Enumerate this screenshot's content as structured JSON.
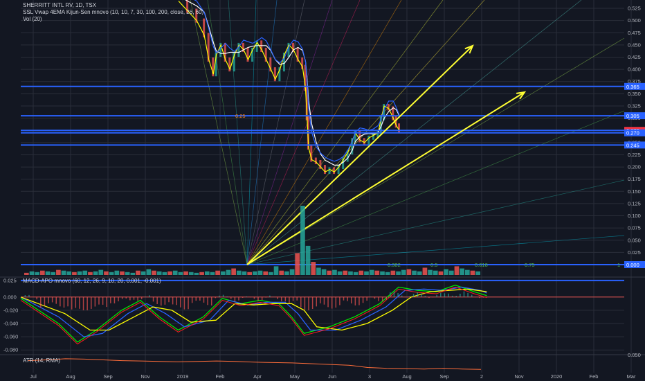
{
  "legend": {
    "symbol": "SHERRITT INTL RV, 1D, TSX",
    "ssl": "SSL Vwap 4EMA Kijun-Sen mnovo (10, 10, 7, 30, 100, 200, close, 26, 60)",
    "vol": "Vol (20)",
    "macd": "MACD-APO mnovo (60, 12, 26, 9, 10, 20, 0.001, -0.001)",
    "atr": "ATR (14, RMA)"
  },
  "colors": {
    "background": "#131722",
    "grid": "#2a2e39",
    "axis_text": "#b2b5be",
    "bull": "#26a69a",
    "bear": "#ef5350",
    "hline": "#2962ff",
    "arrow": "#ffff33",
    "white_line": "#ffffff",
    "blue_line": "#2962ff",
    "yellow_line": "#ffff00",
    "green_line": "#00e600",
    "red_line": "#ff2020",
    "atr_line": "#ff6d3a",
    "badge_red": "#f23645"
  },
  "chart_data": [
    {
      "type": "line",
      "panel": "price",
      "title": "SHERRITT INTL RV, 1D, TSX",
      "x_axis_labels": [
        "Jul",
        "Aug",
        "Sep",
        "Nov",
        "2019",
        "Feb",
        "Apr",
        "May",
        "Jun",
        "3",
        "Aug",
        "Sep",
        "2",
        "Nov",
        "2020",
        "Feb",
        "Mar"
      ],
      "y_axis_labels": [
        "0.525",
        "0.500",
        "0.475",
        "0.450",
        "0.425",
        "0.400",
        "0.375",
        "0.350",
        "0.325",
        "0.300",
        "0.275",
        "0.250",
        "0.225",
        "0.200",
        "0.175",
        "0.150",
        "0.125",
        "0.100",
        "0.075",
        "0.050",
        "0.025",
        "0.000"
      ],
      "ylim": [
        0,
        0.535
      ],
      "horizontal_levels": [
        {
          "value": 0.365,
          "label": "0.365"
        },
        {
          "value": 0.305,
          "label": "0.305"
        },
        {
          "value": 0.275,
          "label": "0.275",
          "current": true
        },
        {
          "value": 0.27,
          "label": "0.270"
        },
        {
          "value": 0.245,
          "label": "0.245"
        },
        {
          "value": 0.0,
          "label": "0.000"
        }
      ],
      "fib_labels": [
        "0.25",
        "0.382",
        "0.5",
        "0.618",
        "0.75",
        "1"
      ],
      "price_series": {
        "name": "price",
        "points": [
          [
            0.0,
            0.54
          ],
          [
            0.03,
            0.52
          ],
          [
            0.06,
            0.5
          ],
          [
            0.085,
            0.47
          ],
          [
            0.1,
            0.42
          ],
          [
            0.115,
            0.39
          ],
          [
            0.125,
            0.43
          ],
          [
            0.14,
            0.45
          ],
          [
            0.155,
            0.42
          ],
          [
            0.17,
            0.4
          ],
          [
            0.185,
            0.43
          ],
          [
            0.2,
            0.45
          ],
          [
            0.215,
            0.44
          ],
          [
            0.23,
            0.42
          ],
          [
            0.245,
            0.44
          ],
          [
            0.26,
            0.455
          ],
          [
            0.275,
            0.44
          ],
          [
            0.29,
            0.42
          ],
          [
            0.305,
            0.4
          ],
          [
            0.32,
            0.38
          ],
          [
            0.335,
            0.4
          ],
          [
            0.35,
            0.43
          ],
          [
            0.365,
            0.45
          ],
          [
            0.38,
            0.44
          ],
          [
            0.395,
            0.42
          ],
          [
            0.41,
            0.405
          ],
          [
            0.42,
            0.36
          ],
          [
            0.425,
            0.3
          ],
          [
            0.43,
            0.24
          ],
          [
            0.44,
            0.215
          ],
          [
            0.455,
            0.21
          ],
          [
            0.47,
            0.2
          ],
          [
            0.485,
            0.19
          ],
          [
            0.5,
            0.195
          ],
          [
            0.515,
            0.19
          ],
          [
            0.53,
            0.2
          ],
          [
            0.545,
            0.215
          ],
          [
            0.56,
            0.23
          ],
          [
            0.575,
            0.255
          ],
          [
            0.585,
            0.27
          ],
          [
            0.6,
            0.255
          ],
          [
            0.615,
            0.25
          ],
          [
            0.63,
            0.26
          ],
          [
            0.645,
            0.265
          ],
          [
            0.66,
            0.27
          ],
          [
            0.67,
            0.3
          ],
          [
            0.68,
            0.325
          ],
          [
            0.695,
            0.32
          ],
          [
            0.71,
            0.3
          ],
          [
            0.72,
            0.285
          ],
          [
            0.73,
            0.275
          ]
        ]
      }
    },
    {
      "type": "bar",
      "panel": "volume",
      "title": "Vol (20)",
      "spike_index_fraction": 0.425,
      "values": [
        3,
        5,
        4,
        6,
        5,
        4,
        7,
        6,
        5,
        4,
        5,
        6,
        4,
        5,
        7,
        5,
        4,
        6,
        5,
        4,
        3,
        6,
        5,
        8,
        6,
        5,
        4,
        5,
        6,
        4,
        5,
        4,
        3,
        4,
        5,
        4,
        6,
        5,
        7,
        9,
        6,
        5,
        4,
        5,
        6,
        5,
        4,
        12,
        6,
        5,
        8,
        30,
        95,
        40,
        18,
        10,
        8,
        6,
        7,
        5,
        6,
        5,
        4,
        6,
        5,
        7,
        6,
        5,
        4,
        6,
        5,
        7,
        8,
        6,
        5,
        10,
        7,
        6,
        5,
        8,
        6,
        12,
        9,
        7,
        6,
        5
      ]
    },
    {
      "type": "line",
      "panel": "macd",
      "title": "MACD-APO mnovo (60, 12, 26, 9, 10, 20, 0.001, -0.001)",
      "y_axis_labels": [
        "0.025",
        "0.000",
        "-0.020",
        "-0.040",
        "-0.060",
        "-0.080"
      ],
      "ylim": [
        -0.085,
        0.028
      ],
      "series": [
        {
          "name": "fast",
          "points": [
            [
              0.0,
              -0.002
            ],
            [
              0.06,
              -0.04
            ],
            [
              0.09,
              -0.068
            ],
            [
              0.12,
              -0.05
            ],
            [
              0.16,
              -0.02
            ],
            [
              0.19,
              -0.005
            ],
            [
              0.22,
              -0.03
            ],
            [
              0.25,
              -0.05
            ],
            [
              0.29,
              -0.03
            ],
            [
              0.32,
              -0.002
            ],
            [
              0.35,
              -0.01
            ],
            [
              0.38,
              -0.005
            ],
            [
              0.41,
              -0.01
            ],
            [
              0.43,
              -0.03
            ],
            [
              0.45,
              -0.055
            ],
            [
              0.49,
              -0.045
            ],
            [
              0.53,
              -0.03
            ],
            [
              0.57,
              -0.01
            ],
            [
              0.6,
              0.015
            ],
            [
              0.63,
              0.01
            ],
            [
              0.66,
              0.008
            ],
            [
              0.69,
              0.018
            ],
            [
              0.72,
              0.008
            ],
            [
              0.74,
              0.002
            ]
          ]
        },
        {
          "name": "slow",
          "points": [
            [
              0.0,
              0.0
            ],
            [
              0.06,
              -0.03
            ],
            [
              0.1,
              -0.06
            ],
            [
              0.13,
              -0.055
            ],
            [
              0.17,
              -0.025
            ],
            [
              0.2,
              -0.01
            ],
            [
              0.23,
              -0.025
            ],
            [
              0.26,
              -0.045
            ],
            [
              0.3,
              -0.035
            ],
            [
              0.33,
              -0.005
            ],
            [
              0.36,
              -0.012
            ],
            [
              0.39,
              -0.008
            ],
            [
              0.42,
              -0.008
            ],
            [
              0.44,
              -0.025
            ],
            [
              0.46,
              -0.05
            ],
            [
              0.5,
              -0.05
            ],
            [
              0.54,
              -0.035
            ],
            [
              0.58,
              -0.015
            ],
            [
              0.61,
              0.01
            ],
            [
              0.64,
              0.012
            ],
            [
              0.67,
              0.01
            ],
            [
              0.7,
              0.015
            ],
            [
              0.73,
              0.01
            ],
            [
              0.74,
              0.006
            ]
          ]
        },
        {
          "name": "signal",
          "points": [
            [
              0.0,
              0.0
            ],
            [
              0.07,
              -0.025
            ],
            [
              0.11,
              -0.05
            ],
            [
              0.14,
              -0.05
            ],
            [
              0.18,
              -0.03
            ],
            [
              0.21,
              -0.015
            ],
            [
              0.24,
              -0.02
            ],
            [
              0.27,
              -0.038
            ],
            [
              0.31,
              -0.035
            ],
            [
              0.34,
              -0.01
            ],
            [
              0.37,
              -0.012
            ],
            [
              0.4,
              -0.01
            ],
            [
              0.43,
              -0.01
            ],
            [
              0.45,
              -0.02
            ],
            [
              0.47,
              -0.045
            ],
            [
              0.51,
              -0.05
            ],
            [
              0.55,
              -0.04
            ],
            [
              0.59,
              -0.02
            ],
            [
              0.62,
              0.0
            ],
            [
              0.65,
              0.008
            ],
            [
              0.68,
              0.01
            ],
            [
              0.71,
              0.012
            ],
            [
              0.74,
              0.008
            ]
          ]
        }
      ]
    },
    {
      "type": "line",
      "panel": "atr",
      "title": "ATR (14, RMA)",
      "y_axis_labels": [
        "0.050"
      ],
      "values": [
        0.048,
        0.05,
        0.053,
        0.052,
        0.05,
        0.048,
        0.047,
        0.046,
        0.045,
        0.046,
        0.047,
        0.046,
        0.044,
        0.043,
        0.042,
        0.04,
        0.038,
        0.036,
        0.03,
        0.028,
        0.027,
        0.026,
        0.028,
        0.026,
        0.025
      ]
    }
  ]
}
